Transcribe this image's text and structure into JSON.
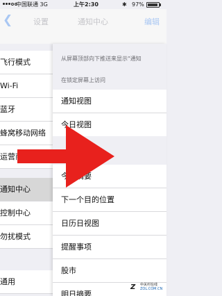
{
  "status_bar": {
    "carrier": "中国联通",
    "network": "3G",
    "time": "上午2:30",
    "bluetooth": "✱",
    "battery": "97%"
  },
  "left_nav": {
    "back_icon": "chevron-left-icon",
    "title": "设置"
  },
  "right_nav": {
    "title": "通知中心",
    "edit_label": "编辑"
  },
  "left_list": {
    "group1": [
      "飞行模式",
      "Wi-Fi",
      "蓝牙",
      "蜂窝移动网络",
      "运营商"
    ],
    "group2": [
      "通知中心",
      "控制中心",
      "勿扰模式"
    ],
    "group3": [
      "通用"
    ]
  },
  "right_panel": {
    "hint": "从屏幕顶部向下推送来显示\"通知",
    "section_lock": "在锁定屏幕上访问",
    "lock_items": [
      "通知视图",
      "今日视图"
    ],
    "today_items": [
      "今日摘要",
      "下一个目的位置",
      "日历日视图",
      "提醒事项",
      "股市",
      "明日摘要"
    ]
  },
  "overlay": {
    "arrow_color": "#e8211d"
  },
  "watermark": {
    "line1": "中关村在线",
    "line2": "ZOL.COM.CN"
  }
}
